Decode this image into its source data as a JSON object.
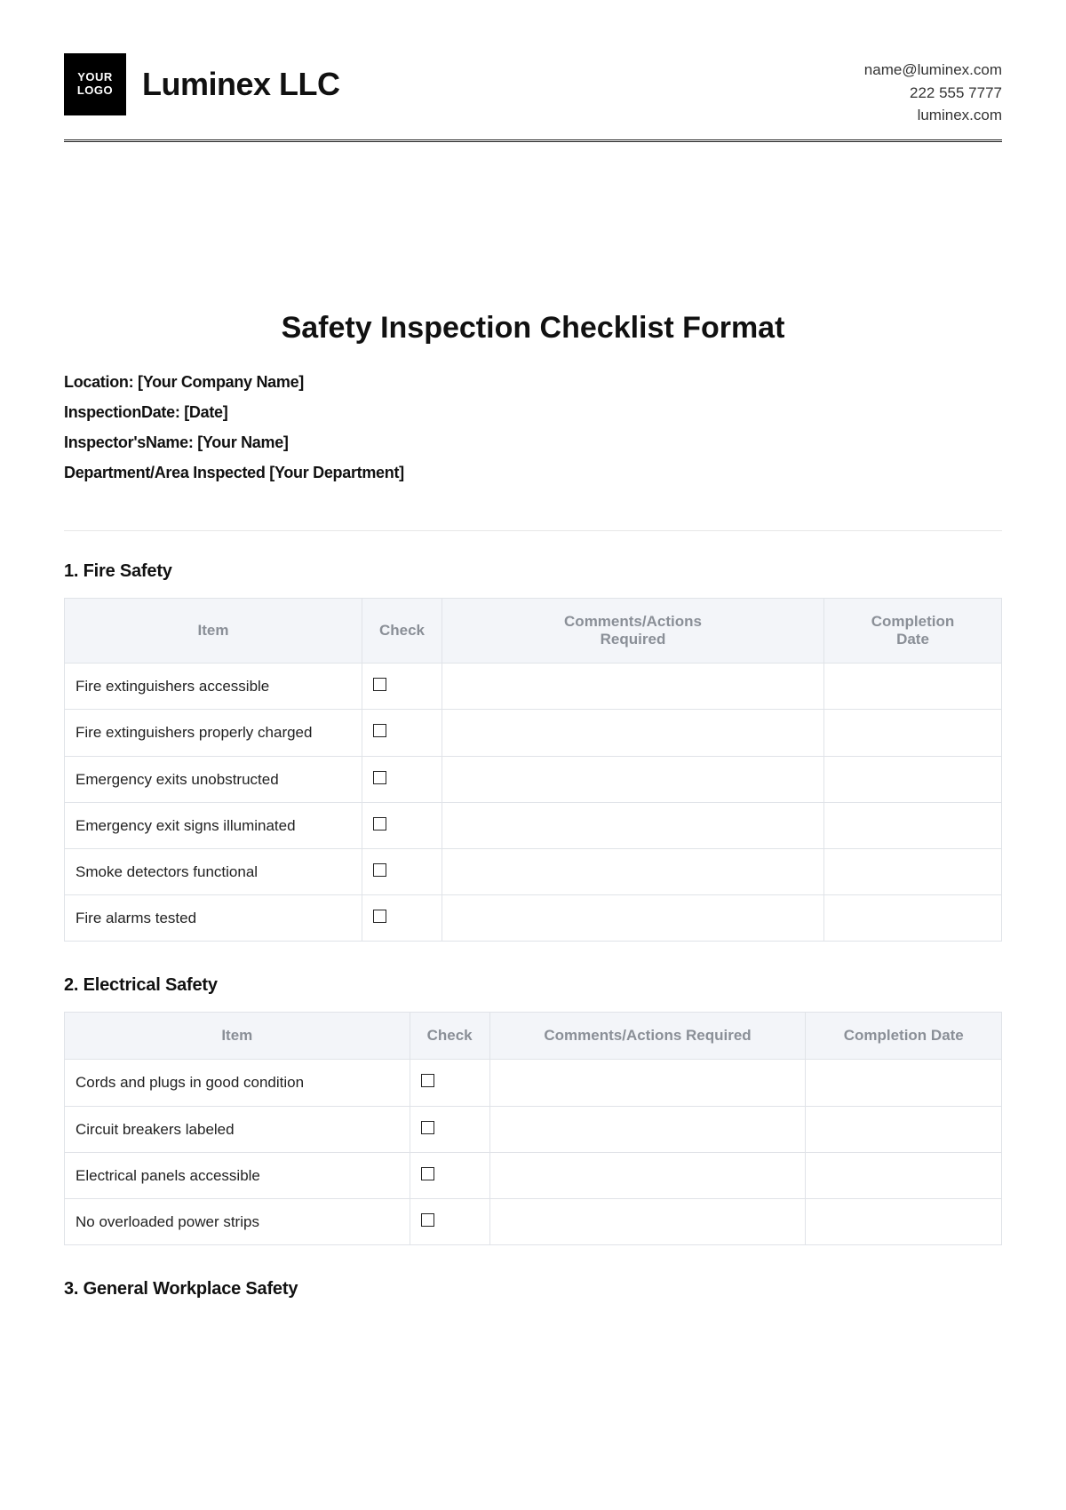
{
  "header": {
    "logo_top": "YOUR",
    "logo_bottom": "LOGO",
    "company": "Luminex LLC",
    "contact": {
      "email": "name@luminex.com",
      "phone": "222 555 7777",
      "site": "luminex.com"
    }
  },
  "title": "Safety Inspection Checklist Format",
  "meta": {
    "location_label": "Location:",
    "location_value": "[Your Company Name]",
    "insp_date_label": "InspectionDate:",
    "insp_date_value": "[Date]",
    "inspector_label": "Inspector'sName:",
    "inspector_value": "[Your Name]",
    "dept_label": "Department/Area Inspected",
    "dept_value": "[Your Department]"
  },
  "columns": {
    "item": "Item",
    "check": "Check",
    "comments_l1": "Comments/Actions",
    "comments_l2": "Required",
    "comments_single": "Comments/Actions Required",
    "completion_l1": "Completion",
    "completion_l2": "Date",
    "completion_single": "Completion Date"
  },
  "sections": [
    {
      "heading": "1. Fire Safety",
      "rows": [
        "Fire extinguishers accessible",
        "Fire extinguishers properly charged",
        "Emergency exits unobstructed",
        "Emergency exit signs illuminated",
        "Smoke detectors functional",
        "Fire alarms tested"
      ]
    },
    {
      "heading": "2. Electrical Safety",
      "rows": [
        "Cords and plugs in good condition",
        "Circuit breakers labeled",
        "Electrical panels accessible",
        "No overloaded power strips"
      ]
    },
    {
      "heading": "3. General Workplace Safety",
      "rows": []
    }
  ]
}
